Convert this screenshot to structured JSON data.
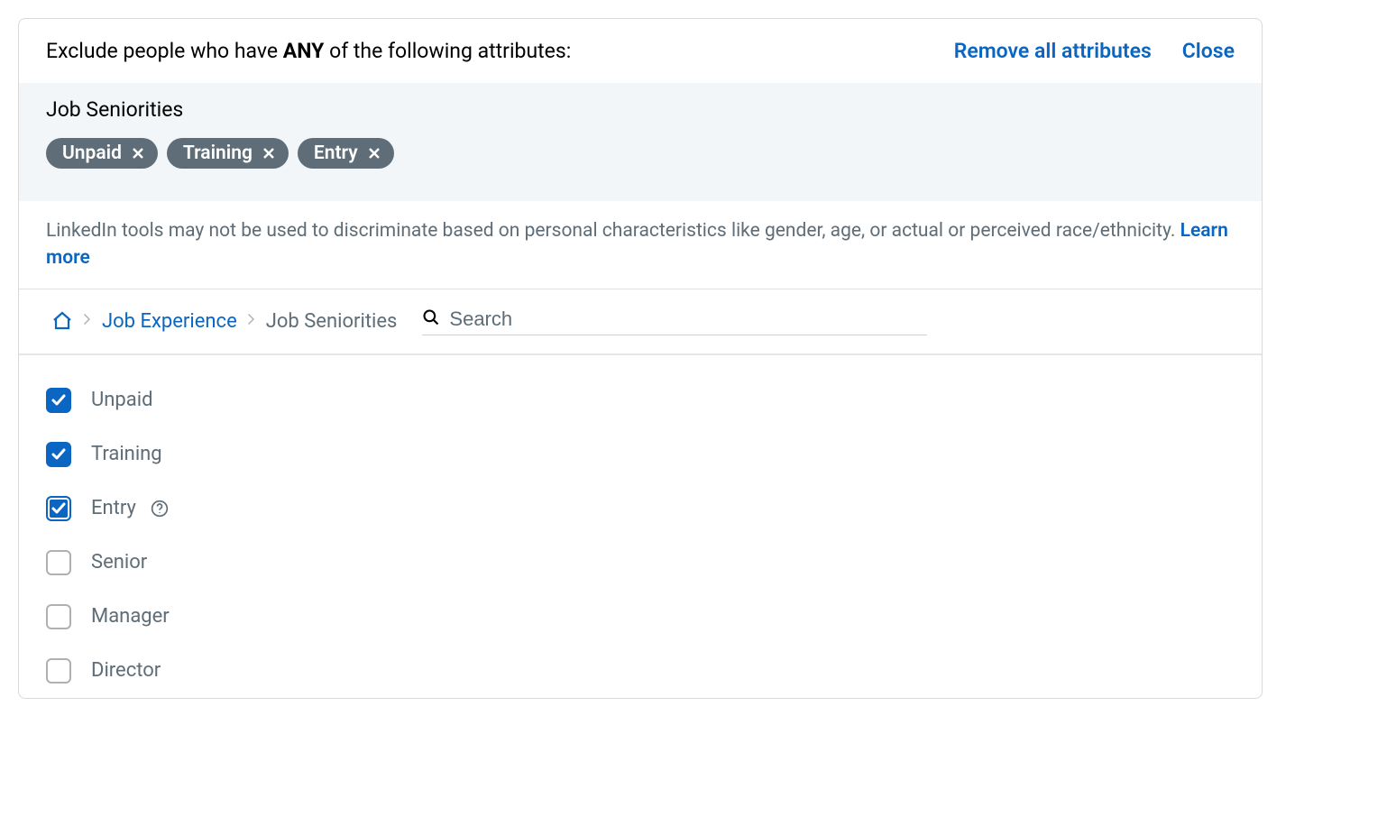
{
  "header": {
    "title_prefix": "Exclude people who have ",
    "title_bold": "ANY",
    "title_suffix": " of the following attributes:",
    "remove_all_label": "Remove all attributes",
    "close_label": "Close"
  },
  "chips": {
    "section_title": "Job Seniorities",
    "items": [
      {
        "label": "Unpaid"
      },
      {
        "label": "Training"
      },
      {
        "label": "Entry"
      }
    ]
  },
  "disclaimer": {
    "text": "LinkedIn tools may not be used to discriminate based on personal characteristics like gender, age, or actual or perceived race/ethnicity. ",
    "link_label": "Learn more"
  },
  "breadcrumb": {
    "link1": "Job Experience",
    "current": "Job Seniorities"
  },
  "search": {
    "placeholder": "Search"
  },
  "options": [
    {
      "label": "Unpaid",
      "checked": true,
      "focused": false,
      "help": false
    },
    {
      "label": "Training",
      "checked": true,
      "focused": false,
      "help": false
    },
    {
      "label": "Entry",
      "checked": true,
      "focused": true,
      "help": true
    },
    {
      "label": "Senior",
      "checked": false,
      "focused": false,
      "help": false
    },
    {
      "label": "Manager",
      "checked": false,
      "focused": false,
      "help": false
    },
    {
      "label": "Director",
      "checked": false,
      "focused": false,
      "help": false
    }
  ]
}
